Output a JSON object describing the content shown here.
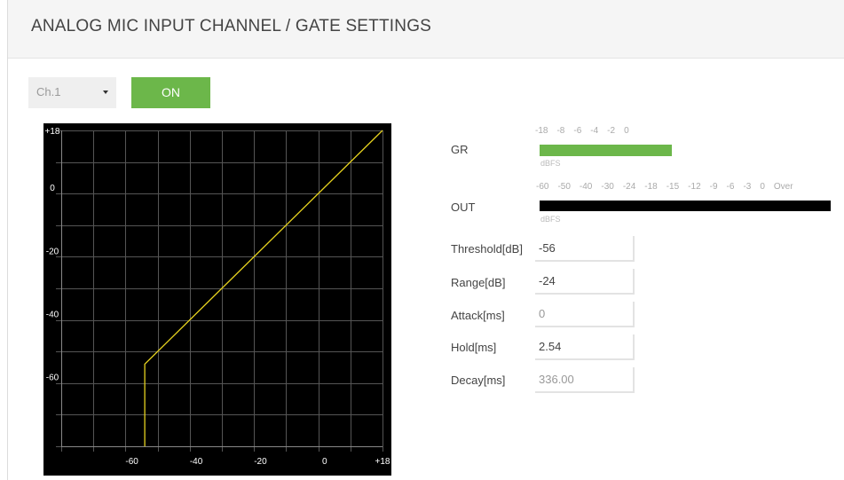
{
  "header": {
    "title": "ANALOG MIC INPUT CHANNEL / GATE SETTINGS"
  },
  "channel": {
    "selected": "Ch.1"
  },
  "power": {
    "label": "ON",
    "color": "#6cb74a"
  },
  "graph": {
    "y_ticks": [
      "+18",
      "0",
      "-20",
      "-40",
      "-60"
    ],
    "x_ticks": [
      "-60",
      "-40",
      "-20",
      "0",
      "+18"
    ],
    "threshold_db": -56,
    "range_db": -24,
    "line_color": "#e6d21f"
  },
  "meters": {
    "gr": {
      "label": "GR",
      "scale": [
        "-18",
        "-8",
        "-6",
        "-4",
        "-2",
        "0"
      ],
      "unit": "dBFS",
      "color": "#6cb74a"
    },
    "out": {
      "label": "OUT",
      "scale": [
        "-60",
        "-50",
        "-40",
        "-30",
        "-24",
        "-18",
        "-15",
        "-12",
        "-9",
        "-6",
        "-3",
        "0",
        "Over"
      ],
      "unit": "dBFS",
      "color": "#000000"
    }
  },
  "params": {
    "threshold": {
      "label": "Threshold[dB]",
      "value": "-56"
    },
    "range": {
      "label": "Range[dB]",
      "value": "-24"
    },
    "attack": {
      "label": "Attack[ms]",
      "value": "0"
    },
    "hold": {
      "label": "Hold[ms]",
      "value": "2.54"
    },
    "decay": {
      "label": "Decay[ms]",
      "value": "336.00"
    }
  }
}
